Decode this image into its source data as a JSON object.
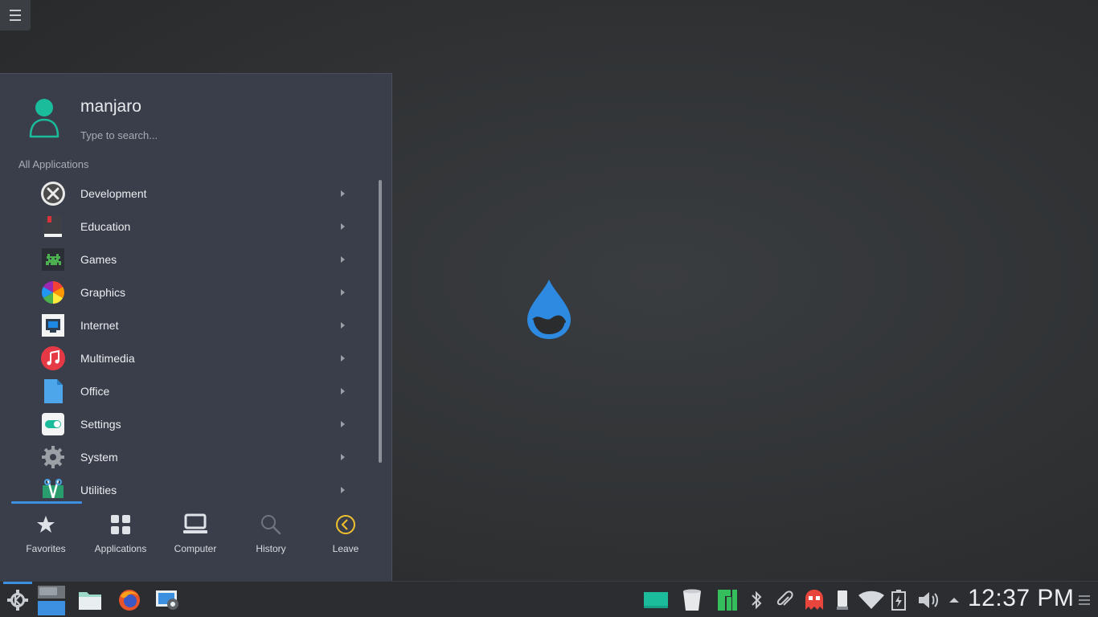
{
  "user": {
    "name": "manjaro"
  },
  "search": {
    "placeholder": "Type to search..."
  },
  "section": {
    "title": "All Applications"
  },
  "apps": [
    {
      "label": "Development",
      "icon": "development-icon"
    },
    {
      "label": "Education",
      "icon": "education-icon"
    },
    {
      "label": "Games",
      "icon": "games-icon"
    },
    {
      "label": "Graphics",
      "icon": "graphics-icon"
    },
    {
      "label": "Internet",
      "icon": "internet-icon"
    },
    {
      "label": "Multimedia",
      "icon": "multimedia-icon"
    },
    {
      "label": "Office",
      "icon": "office-icon"
    },
    {
      "label": "Settings",
      "icon": "settings-icon"
    },
    {
      "label": "System",
      "icon": "system-icon"
    },
    {
      "label": "Utilities",
      "icon": "utilities-icon"
    }
  ],
  "tabs": [
    {
      "label": "Favorites",
      "icon": "star-icon"
    },
    {
      "label": "Applications",
      "icon": "grid-icon"
    },
    {
      "label": "Computer",
      "icon": "computer-icon"
    },
    {
      "label": "History",
      "icon": "history-icon"
    },
    {
      "label": "Leave",
      "icon": "leave-icon"
    }
  ],
  "taskbar": {
    "clock": "12:37 PM"
  },
  "colors": {
    "accent": "#3d8fe0",
    "manjaro_green": "#1abc9c",
    "leave_yellow": "#f0c22e",
    "panel_bg": "#3a3e4a"
  }
}
